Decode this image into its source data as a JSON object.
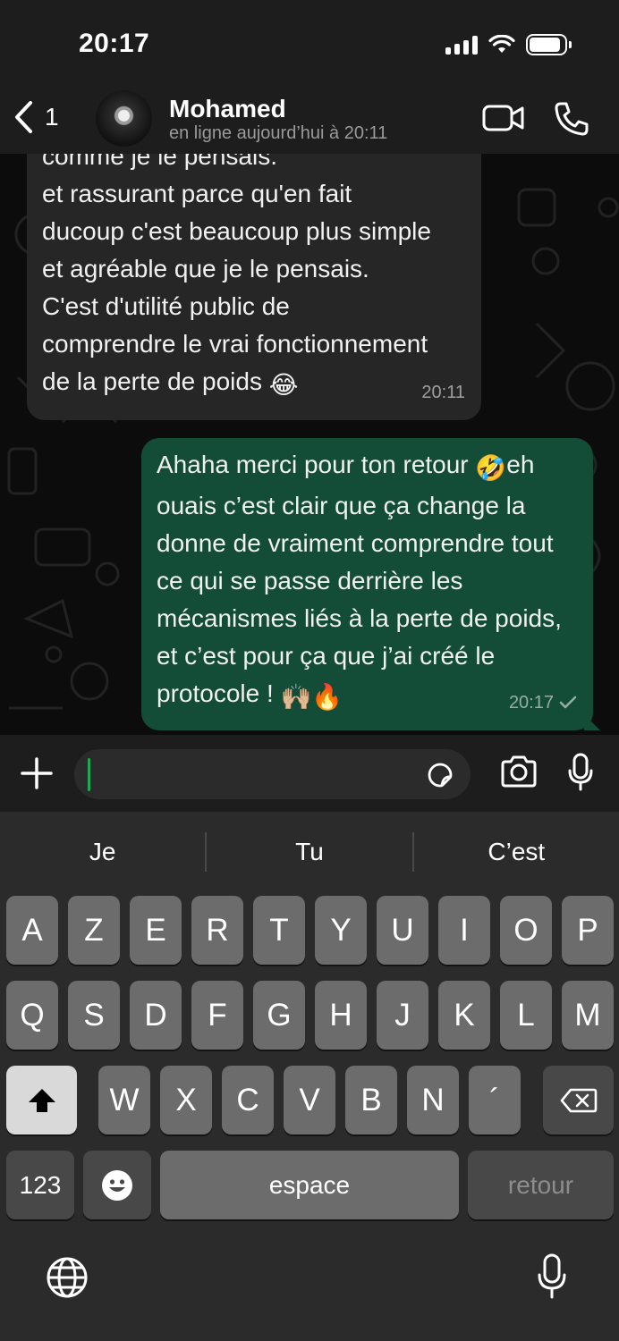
{
  "status_bar": {
    "time": "20:17",
    "battery_level": 0.9
  },
  "header": {
    "back_count": "1",
    "contact_name": "Mohamed",
    "contact_status": "en ligne aujourd’hui à 20:11"
  },
  "messages": {
    "incoming": {
      "lines": [
        "comme je le pensais.",
        "et rassurant parce qu'en fait",
        "ducoup c'est beaucoup plus simple",
        "et agréable que je le pensais.",
        "C'est d'utilité public de",
        "comprendre le vrai fonctionnement",
        "de la perte de poids"
      ],
      "emoji": "😂",
      "time": "20:11"
    },
    "outgoing": {
      "text_a": "Ahaha merci pour ton retour ",
      "emoji_a": "🤣",
      "text_b": "eh ouais c’est clair que ça change la donne de vraiment comprendre tout ce qui se passe derrière les mécanismes liés à la perte de poids, et c’est pour ça que j’ai créé le protocole ! ",
      "emoji_b": "🙌🏼🔥",
      "time": "20:17",
      "status_icon": "check-icon"
    }
  },
  "input": {
    "value": ""
  },
  "keyboard": {
    "suggestions": [
      "Je",
      "Tu",
      "C’est"
    ],
    "row1": [
      "A",
      "Z",
      "E",
      "R",
      "T",
      "Y",
      "U",
      "I",
      "O",
      "P"
    ],
    "row2": [
      "Q",
      "S",
      "D",
      "F",
      "G",
      "H",
      "J",
      "K",
      "L",
      "M"
    ],
    "row3": [
      "W",
      "X",
      "C",
      "V",
      "B",
      "N",
      "´"
    ],
    "numbers_label": "123",
    "space_label": "espace",
    "return_label": "retour"
  },
  "colors": {
    "outgoing_bubble": "#134d37",
    "incoming_bubble": "#262626",
    "caret": "#1fa855"
  }
}
